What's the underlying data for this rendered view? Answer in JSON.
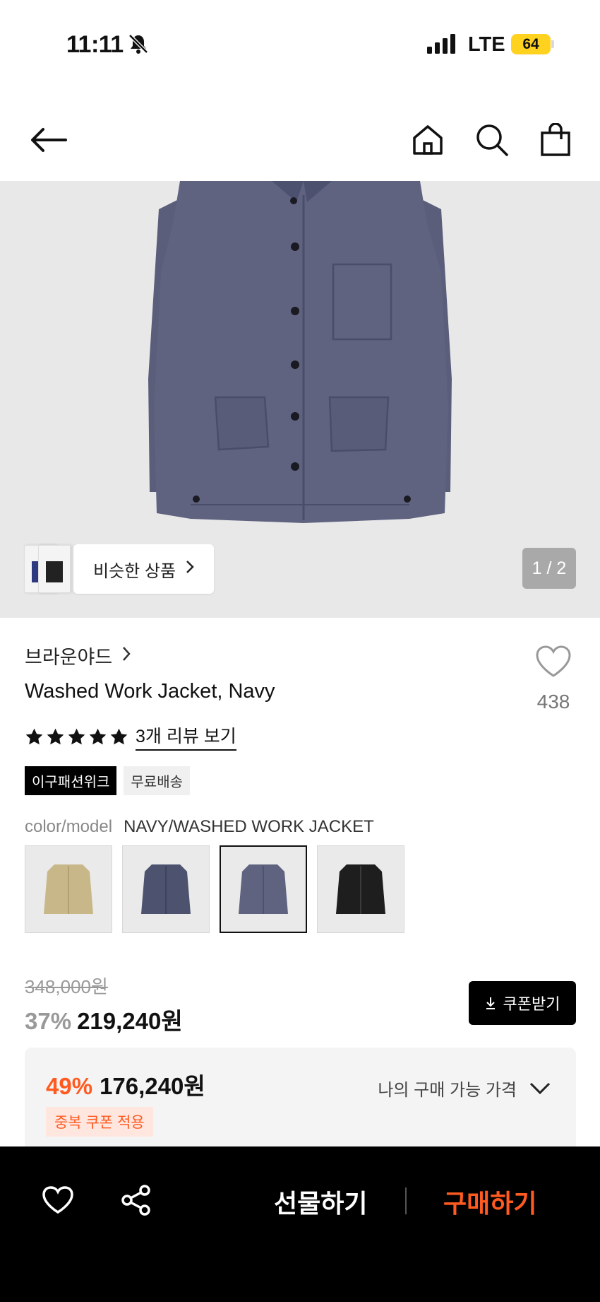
{
  "status_bar": {
    "time": "11:11",
    "network": "LTE",
    "battery": "64"
  },
  "nav": {
    "back": "arrow-left-icon",
    "home": "home-icon",
    "search": "search-icon",
    "bag": "bag-icon"
  },
  "gallery": {
    "similar_label": "비슷한 상품",
    "counter": "1 / 2"
  },
  "product": {
    "brand": "브라운야드",
    "title": "Washed Work Jacket, Navy",
    "likes": "438",
    "rating_stars": 5,
    "review_link": "3개 리뷰 보기",
    "badges": [
      "이구패션위크",
      "무료배송"
    ]
  },
  "option": {
    "label": "color/model",
    "value": "NAVY/WASHED WORK JACKET",
    "swatches": [
      "beige",
      "navy",
      "navy-washed",
      "black"
    ],
    "selected_index": 2
  },
  "pricing": {
    "original": "348,000원",
    "discount": "37%",
    "price": "219,240원",
    "coupon_button": "쿠폰받기",
    "best_discount": "49%",
    "best_price": "176,240원",
    "coupon_tag": "중복 쿠폰 적용",
    "my_price_label": "나의 구매 가능 가격"
  },
  "bottom_bar": {
    "gift_label": "선물하기",
    "buy_label": "구매하기"
  },
  "colors": {
    "accent": "#ff5a1f",
    "battery": "#ffd21f",
    "hero_bg": "#e8e8e8"
  }
}
